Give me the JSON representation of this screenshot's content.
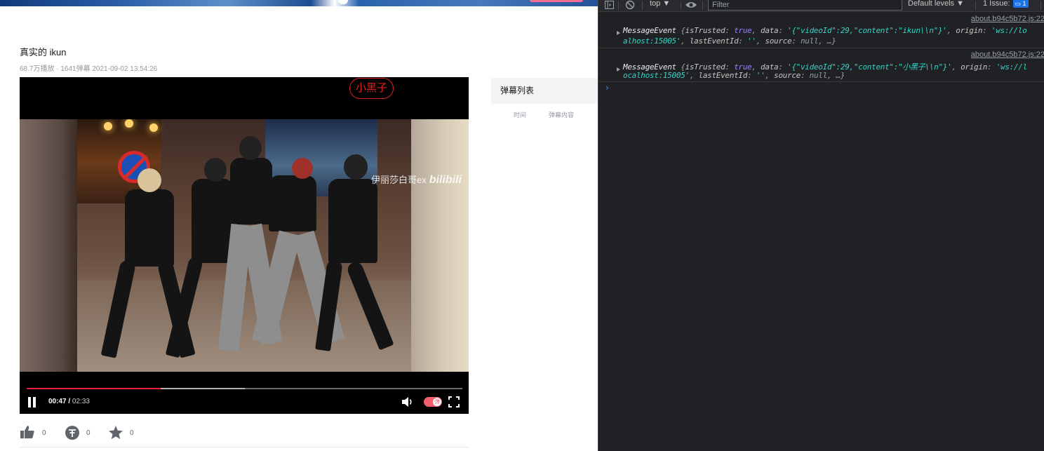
{
  "page": {
    "title": "真实的 ikun",
    "meta": "68.7万播放 · 1641弹幕 2021-09-02 13:54:26",
    "danmaku_bubble": "小黑子",
    "watermark_text": "伊丽莎白哥ex",
    "watermark_logo": "bilibili",
    "player": {
      "current_time": "00:47 /",
      "total_time": "02:33",
      "played_fraction": 0.307,
      "buffered_fraction": 0.5,
      "danmaku_toggle_label": "弹"
    },
    "actions": {
      "like_count": "0",
      "coin_count": "0",
      "fav_count": "0"
    },
    "danmaku_panel": {
      "title": "弹幕列表",
      "col_time": "时间",
      "col_content": "弹幕内容"
    },
    "colors": {
      "accent_red": "#e0203a",
      "bubble_red": "#e02020",
      "toggle_pink": "#f25d6a"
    }
  },
  "devtools": {
    "toolbar": {
      "context": "top ▼",
      "filter_placeholder": "Filter",
      "levels": "Default levels ▼",
      "issues": "1 Issue:",
      "issues_badge": "1"
    },
    "logs": [
      {
        "source": "about.b94c5b72.js:22",
        "line1": {
          "name": "MessageEvent",
          "k1": "isTrusted",
          "v1": "true",
          "k2": "data",
          "v2": "'{\"videoId\":29,\"content\":\"ikun\\\\n\"}'",
          "k3": "origin",
          "v3": "'ws://lo"
        },
        "line2": {
          "v3_cont": "alhost:15005'",
          "k4": "lastEventId",
          "v4": "''",
          "k5": "source",
          "v5": "null",
          "tail": "…}"
        }
      },
      {
        "source": "about.b94c5b72.js:22",
        "line1": {
          "name": "MessageEvent",
          "k1": "isTrusted",
          "v1": "true",
          "k2": "data",
          "v2": "'{\"videoId\":29,\"content\":\"小黑子\\\\n\"}'",
          "k3": "origin",
          "v3": "'ws://l"
        },
        "line2": {
          "v3_cont": "ocalhost:15005'",
          "k4": "lastEventId",
          "v4": "''",
          "k5": "source",
          "v5": "null",
          "tail": "…}"
        }
      }
    ],
    "prompt": "›"
  }
}
